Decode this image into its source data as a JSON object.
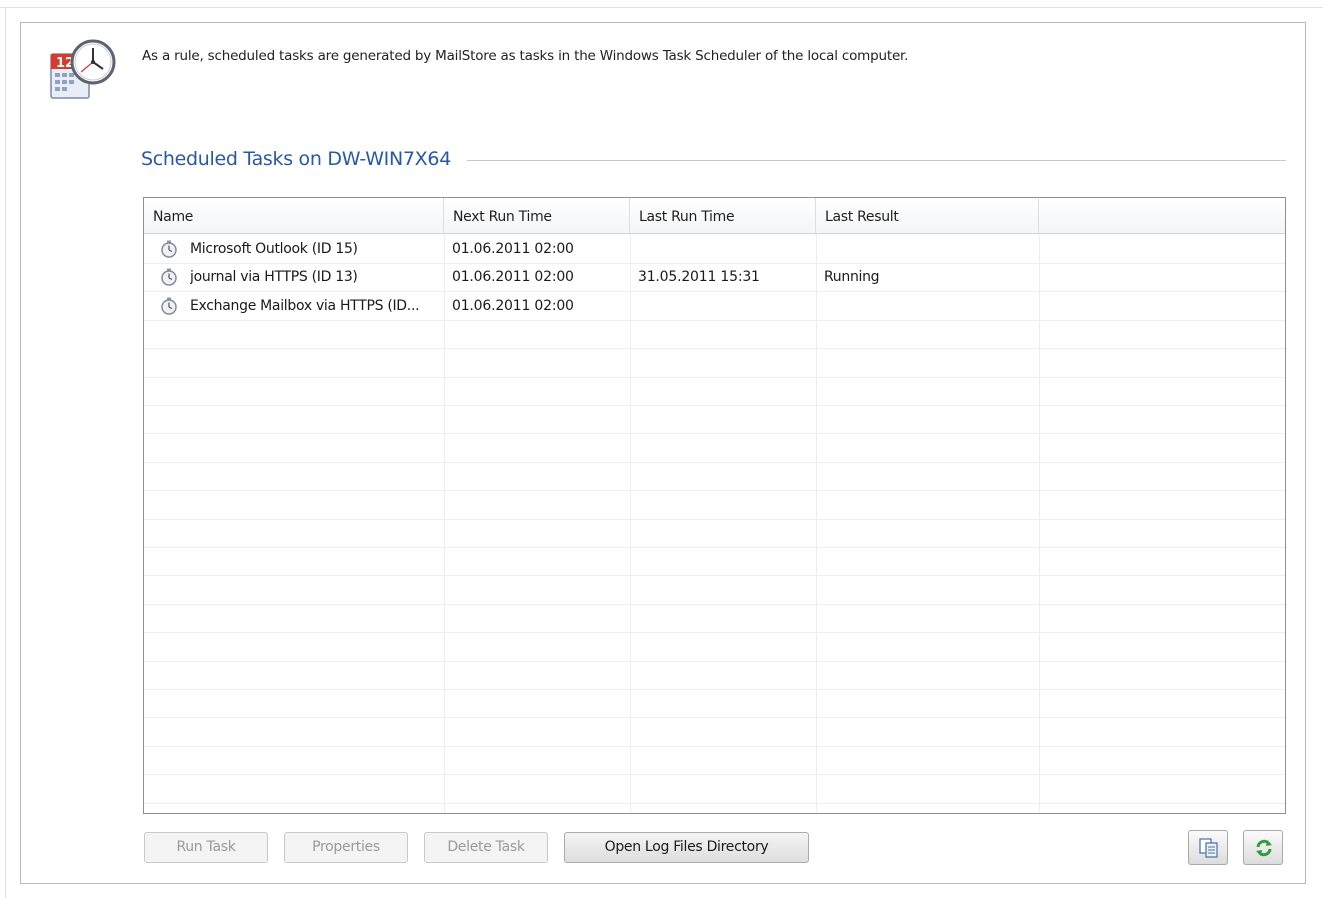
{
  "intro": {
    "text": "As a rule, scheduled tasks are generated by MailStore as tasks in the Windows Task Scheduler of the local computer."
  },
  "section": {
    "title": "Scheduled Tasks on DW-WIN7X64"
  },
  "table": {
    "columns": [
      "Name",
      "Next Run Time",
      "Last Run Time",
      "Last Result"
    ],
    "rows": [
      {
        "name": "Microsoft Outlook (ID 15)",
        "next_run": "01.06.2011 02:00",
        "last_run": "",
        "last_result": ""
      },
      {
        "name": "journal via HTTPS (ID 13)",
        "next_run": "01.06.2011 02:00",
        "last_run": "31.05.2011 15:31",
        "last_result": "Running"
      },
      {
        "name": "Exchange Mailbox via HTTPS (ID...",
        "next_run": "01.06.2011 02:00",
        "last_run": "",
        "last_result": ""
      }
    ]
  },
  "buttons": {
    "run_task": "Run Task",
    "properties": "Properties",
    "delete_task": "Delete Task",
    "open_log": "Open Log Files Directory"
  },
  "icons": {
    "header": "calendar-clock-icon",
    "task": "stopwatch-icon",
    "copy": "copy-icon",
    "refresh": "refresh-icon"
  },
  "colors": {
    "section_title": "#2a58a8",
    "refresh_green": "#2f9e3a"
  }
}
